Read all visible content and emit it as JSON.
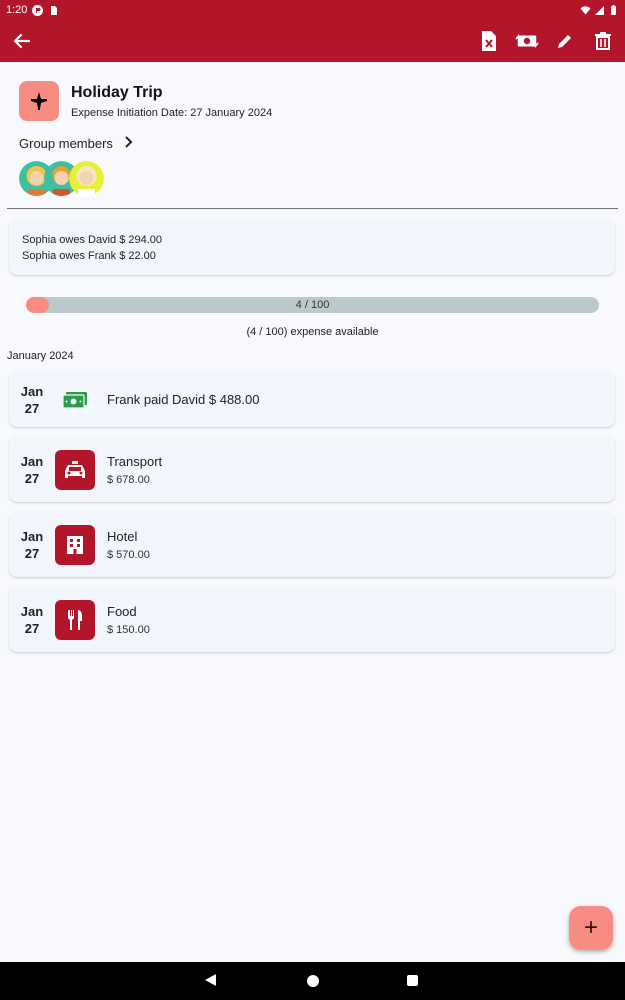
{
  "status_bar": {
    "time": "1:20",
    "bg_color": "#b3152a"
  },
  "app_bar": {
    "back_icon": "arrow-back-icon",
    "actions": [
      "excel-export-icon",
      "settle-money-icon",
      "edit-icon",
      "delete-icon"
    ]
  },
  "trip": {
    "title": "Holiday Trip",
    "date_label": "Expense Initiation Date: 27 January 2024",
    "icon": "airplane-icon"
  },
  "group": {
    "label": "Group members",
    "member_count": 3
  },
  "owes": [
    "Sophia owes David $ 294.00",
    "Sophia owes Frank $ 22.00"
  ],
  "progress": {
    "label": "4 / 100",
    "value": 4,
    "max": 100,
    "caption": "(4 / 100) expense available"
  },
  "month": "January 2024",
  "expenses": [
    {
      "month": "Jan",
      "day": "27",
      "title": "Frank paid David $ 488.00",
      "amount": "",
      "icon": "cash-icon"
    },
    {
      "month": "Jan",
      "day": "27",
      "title": "Transport",
      "amount": "$ 678.00",
      "icon": "taxi-icon"
    },
    {
      "month": "Jan",
      "day": "27",
      "title": "Hotel",
      "amount": "$ 570.00",
      "icon": "building-icon"
    },
    {
      "month": "Jan",
      "day": "27",
      "title": "Food",
      "amount": "$ 150.00",
      "icon": "restaurant-icon"
    }
  ],
  "fab": {
    "label": "+"
  },
  "colors": {
    "primary": "#b3152a",
    "accent": "#f88b82",
    "cash": "#2e9b4a"
  }
}
